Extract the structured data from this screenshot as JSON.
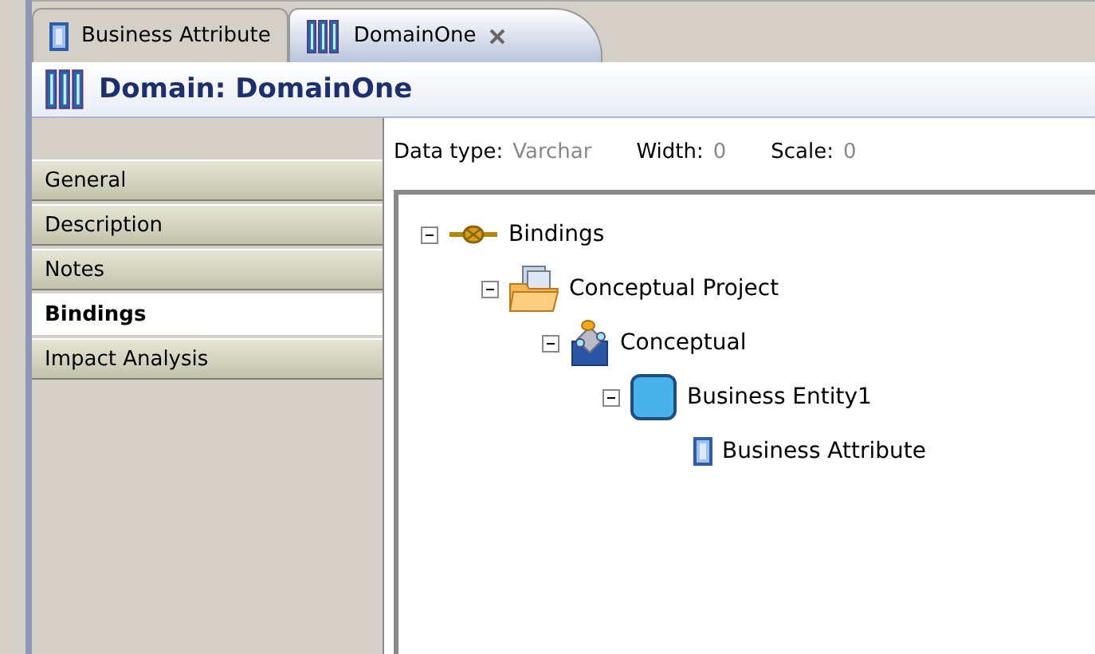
{
  "editor_tabs": [
    {
      "label": "Business Attribute",
      "kind": "attribute",
      "selected": false,
      "closable": false
    },
    {
      "label": "DomainOne",
      "kind": "domain",
      "selected": true,
      "closable": true
    }
  ],
  "header": {
    "title": "Domain: DomainOne",
    "kind": "domain"
  },
  "sidebar": {
    "items": [
      {
        "label": "General",
        "selected": false
      },
      {
        "label": "Description",
        "selected": false
      },
      {
        "label": "Notes",
        "selected": false
      },
      {
        "label": "Bindings",
        "selected": true
      },
      {
        "label": "Impact Analysis",
        "selected": false
      }
    ]
  },
  "fields": [
    {
      "label": "Data type:",
      "value": "Varchar"
    },
    {
      "label": "Width:",
      "value": "0"
    },
    {
      "label": "Scale:",
      "value": "0"
    }
  ],
  "tree": [
    {
      "label": "Bindings",
      "kind": "bindings",
      "expanded": true,
      "children": [
        {
          "label": "Conceptual Project",
          "kind": "project",
          "expanded": true,
          "children": [
            {
              "label": "Conceptual",
              "kind": "model",
              "expanded": true,
              "children": [
                {
                  "label": "Business Entity1",
                  "kind": "entity",
                  "expanded": true,
                  "children": [
                    {
                      "label": "Business Attribute",
                      "kind": "attribute"
                    }
                  ]
                }
              ]
            }
          ]
        }
      ]
    }
  ]
}
